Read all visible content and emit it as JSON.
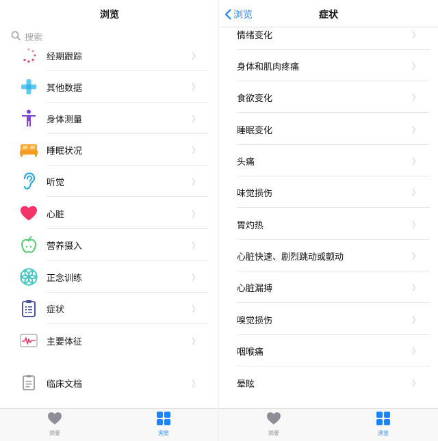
{
  "left": {
    "title": "浏览",
    "search_placeholder": "搜索",
    "items": [
      {
        "label": "经期跟踪",
        "icon": "cycle-tracking-icon"
      },
      {
        "label": "其他数据",
        "icon": "other-data-icon"
      },
      {
        "label": "身体测量",
        "icon": "body-measurement-icon"
      },
      {
        "label": "睡眠状况",
        "icon": "sleep-bed-icon"
      },
      {
        "label": "听觉",
        "icon": "ear-icon"
      },
      {
        "label": "心脏",
        "icon": "heart-icon"
      },
      {
        "label": "营养摄入",
        "icon": "apple-icon"
      },
      {
        "label": "正念训练",
        "icon": "mindfulness-icon"
      },
      {
        "label": "症状",
        "icon": "clipboard-icon"
      },
      {
        "label": "主要体征",
        "icon": "vitals-icon"
      },
      {
        "label": "临床文档",
        "icon": "clinical-document-icon"
      }
    ]
  },
  "right": {
    "back_label": "浏览",
    "title": "症状",
    "items": [
      "情绪变化",
      "身体和肌肉疼痛",
      "食欲变化",
      "睡眠变化",
      "头痛",
      "味觉损伤",
      "胃灼热",
      "心脏快速、剧烈跳动或颤动",
      "心脏漏搏",
      "嗅觉损伤",
      "咽喉痛",
      "晕眩"
    ]
  },
  "tabs": [
    {
      "label": "摘要",
      "icon": "heart-icon",
      "active": false
    },
    {
      "label": "浏览",
      "icon": "grid-icon",
      "active": true
    }
  ],
  "colors": {
    "accent": "#1a84ff",
    "heart": "#f5326a",
    "chevron": "#c7c7cc"
  }
}
